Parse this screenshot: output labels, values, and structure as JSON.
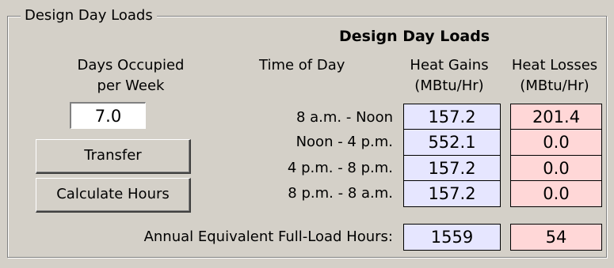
{
  "group_label": "Design Day Loads",
  "table_title": "Design Day Loads",
  "days": {
    "label_line1": "Days Occupied",
    "label_line2": "per Week",
    "value": "7.0"
  },
  "buttons": {
    "transfer": "Transfer",
    "calculate_hours": "Calculate Hours"
  },
  "columns": {
    "time_of_day": "Time of Day",
    "heat_gains_line1": "Heat Gains",
    "heat_gains_line2": "(MBtu/Hr)",
    "heat_losses_line1": "Heat Losses",
    "heat_losses_line2": "(MBtu/Hr)"
  },
  "rows": [
    {
      "time": "8 a.m. - Noon",
      "gain": "157.2",
      "loss": "201.4"
    },
    {
      "time": "Noon - 4 p.m.",
      "gain": "552.1",
      "loss": "0.0"
    },
    {
      "time": "4 p.m. - 8 p.m.",
      "gain": "157.2",
      "loss": "0.0"
    },
    {
      "time": "8 p.m. - 8 a.m.",
      "gain": "157.2",
      "loss": "0.0"
    }
  ],
  "annual": {
    "label": "Annual Equivalent Full-Load Hours:",
    "gain": "1559",
    "loss": "54"
  },
  "colors": {
    "gain_background": "#e6e6ff",
    "loss_background": "#ffd7d7",
    "panel_background": "#d4d0c8"
  }
}
